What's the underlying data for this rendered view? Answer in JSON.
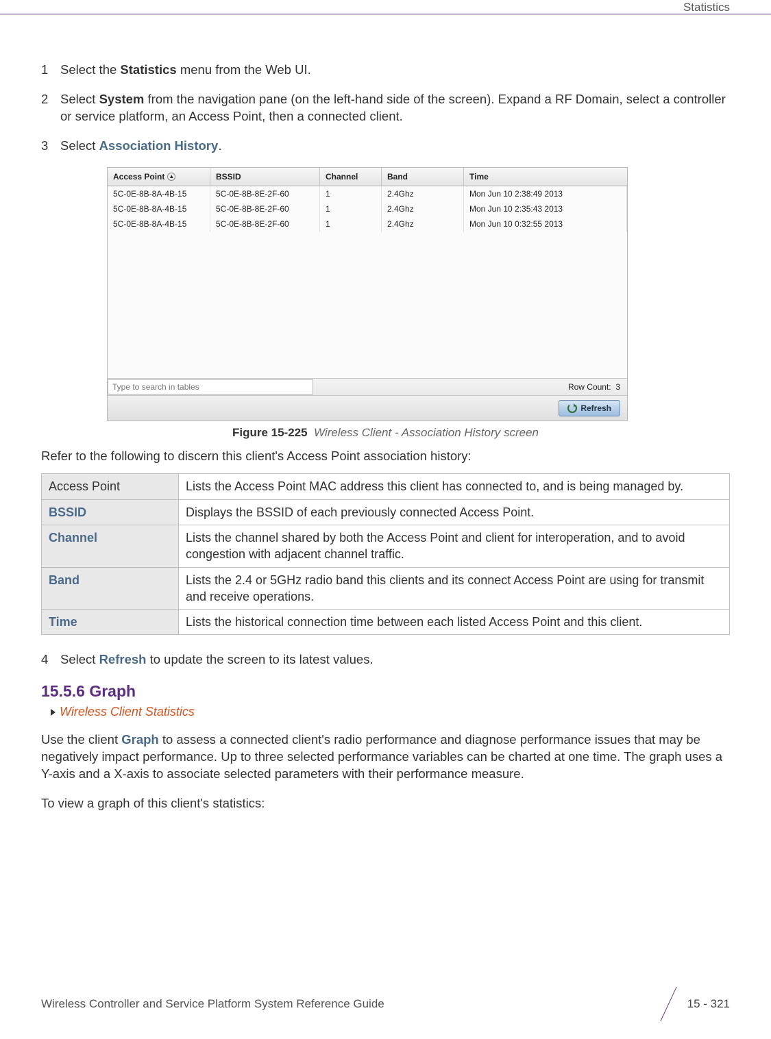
{
  "header": {
    "section_label": "Statistics"
  },
  "steps": [
    {
      "pre": "Select the ",
      "kw": "Statistics",
      "post": " menu from the Web UI.",
      "kw_style": "kw"
    },
    {
      "pre": "Select ",
      "kw": "System",
      "post": " from the navigation pane (on the left-hand side of the screen). Expand a RF Domain, select a controller or service platform, an Access Point, then a connected client.",
      "kw_style": "kw"
    },
    {
      "pre": "Select ",
      "kw": "Association History",
      "post": ".",
      "kw_style": "kw-blue"
    }
  ],
  "fig_table": {
    "columns": [
      "Access Point",
      "BSSID",
      "Channel",
      "Band",
      "Time"
    ],
    "rows": [
      {
        "ap": "5C-0E-8B-8A-4B-15",
        "bssid": "5C-0E-8B-8E-2F-60",
        "channel": "1",
        "band": "2.4Ghz",
        "time": "Mon Jun 10 2:38:49 2013"
      },
      {
        "ap": "5C-0E-8B-8A-4B-15",
        "bssid": "5C-0E-8B-8E-2F-60",
        "channel": "1",
        "band": "2.4Ghz",
        "time": "Mon Jun 10 2:35:43 2013"
      },
      {
        "ap": "5C-0E-8B-8A-4B-15",
        "bssid": "5C-0E-8B-8E-2F-60",
        "channel": "1",
        "band": "2.4Ghz",
        "time": "Mon Jun 10 0:32:55 2013"
      }
    ],
    "search_placeholder": "Type to search in tables",
    "rowcount_label": "Row Count:",
    "rowcount_value": "3",
    "refresh_label": "Refresh"
  },
  "figure_caption": {
    "number": "Figure 15-225",
    "title": "Wireless Client - Association History screen"
  },
  "intro_para": "Refer to the following to discern this client's Access Point association history:",
  "desc_table": [
    {
      "term": "Access Point",
      "desc": "Lists the Access Point MAC address this client has connected to, and is being managed by."
    },
    {
      "term": "BSSID",
      "desc": "Displays the BSSID of each previously connected Access Point."
    },
    {
      "term": "Channel",
      "desc": "Lists the channel shared by both the Access Point and client for interoperation, and to avoid congestion with adjacent channel traffic."
    },
    {
      "term": "Band",
      "desc": "Lists the 2.4 or 5GHz radio band this clients and its connect Access Point are using for transmit and receive operations."
    },
    {
      "term": "Time",
      "desc": "Lists the historical connection time between each listed Access Point and this client."
    }
  ],
  "step4": {
    "num": "4",
    "pre": "Select ",
    "kw": "Refresh",
    "post": " to update the screen to its latest values."
  },
  "section": {
    "heading": "15.5.6 Graph",
    "breadcrumb": "Wireless Client Statistics",
    "para1_pre": "Use the client ",
    "para1_kw": "Graph",
    "para1_post": " to assess a connected client's radio performance and diagnose performance issues that may be negatively impact performance. Up to three selected performance variables can be charted at one time. The graph uses a Y-axis and a X-axis to associate selected parameters with their performance measure.",
    "para2": "To view a graph of this client's statistics:"
  },
  "footer": {
    "doc_title": "Wireless Controller and Service Platform System Reference Guide",
    "page": "15 - 321"
  }
}
